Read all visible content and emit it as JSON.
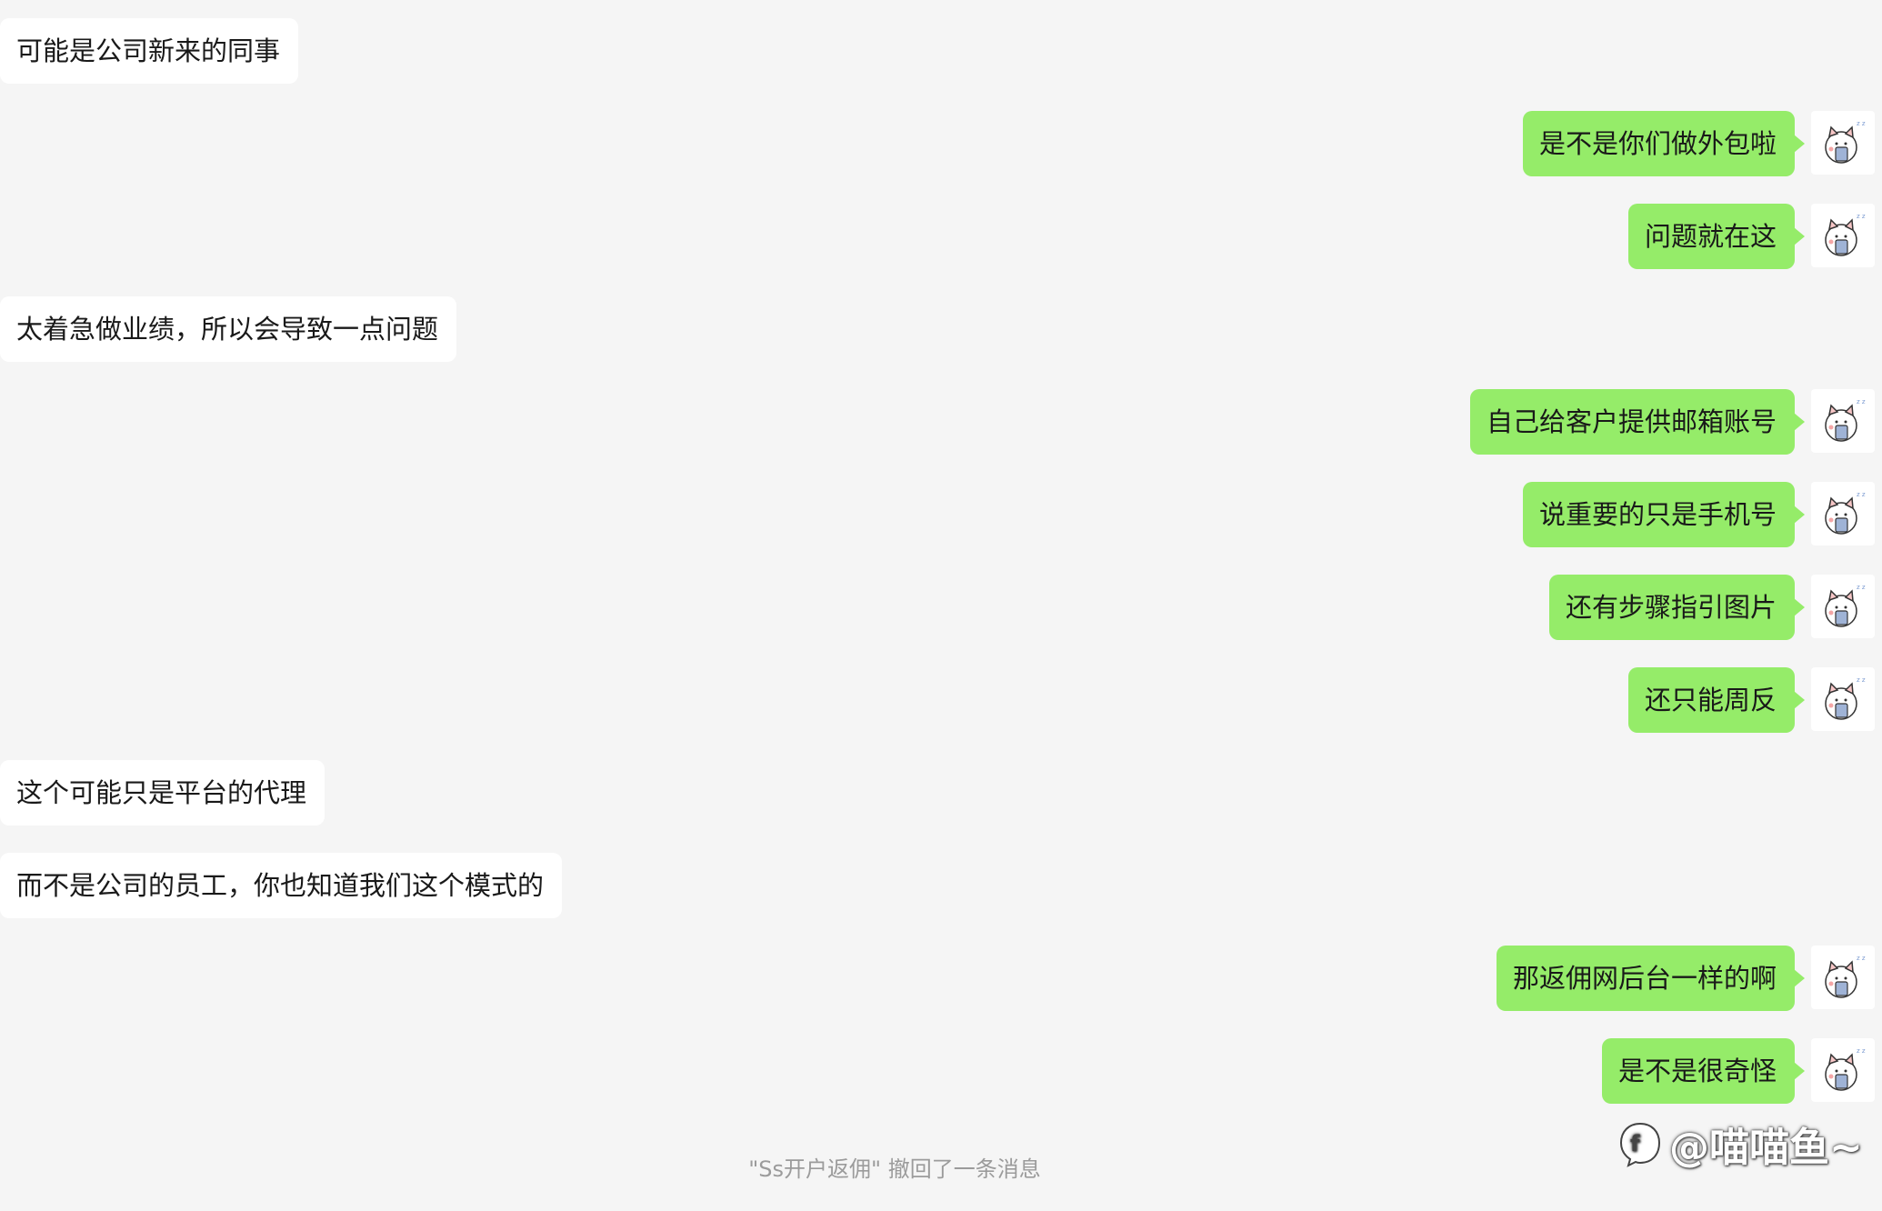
{
  "messages": [
    {
      "side": "left",
      "text": "可能是公司新来的同事"
    },
    {
      "side": "right",
      "text": "是不是你们做外包啦"
    },
    {
      "side": "right",
      "text": "问题就在这"
    },
    {
      "side": "left",
      "text": "太着急做业绩，所以会导致一点问题"
    },
    {
      "side": "right",
      "text": "自己给客户提供邮箱账号"
    },
    {
      "side": "right",
      "text": "说重要的只是手机号"
    },
    {
      "side": "right",
      "text": "还有步骤指引图片"
    },
    {
      "side": "right",
      "text": "还只能周反"
    },
    {
      "side": "left",
      "text": "这个可能只是平台的代理"
    },
    {
      "side": "left",
      "text": "而不是公司的员工，你也知道我们这个模式的"
    },
    {
      "side": "right",
      "text": "那返佣网后台一样的啊"
    },
    {
      "side": "right",
      "text": "是不是很奇怪"
    }
  ],
  "system_note": "\"Ss开户返佣\" 撤回了一条消息",
  "watermark": {
    "handle": "@喵喵鱼~",
    "logo_icon": "zhihu-logo-icon"
  },
  "avatar": {
    "icon": "cat-sticker-avatar-icon"
  },
  "colors": {
    "background": "#f5f5f5",
    "incoming_bubble": "#ffffff",
    "outgoing_bubble": "#95ec69",
    "text": "#191919",
    "system_text": "#9b9b9b"
  }
}
